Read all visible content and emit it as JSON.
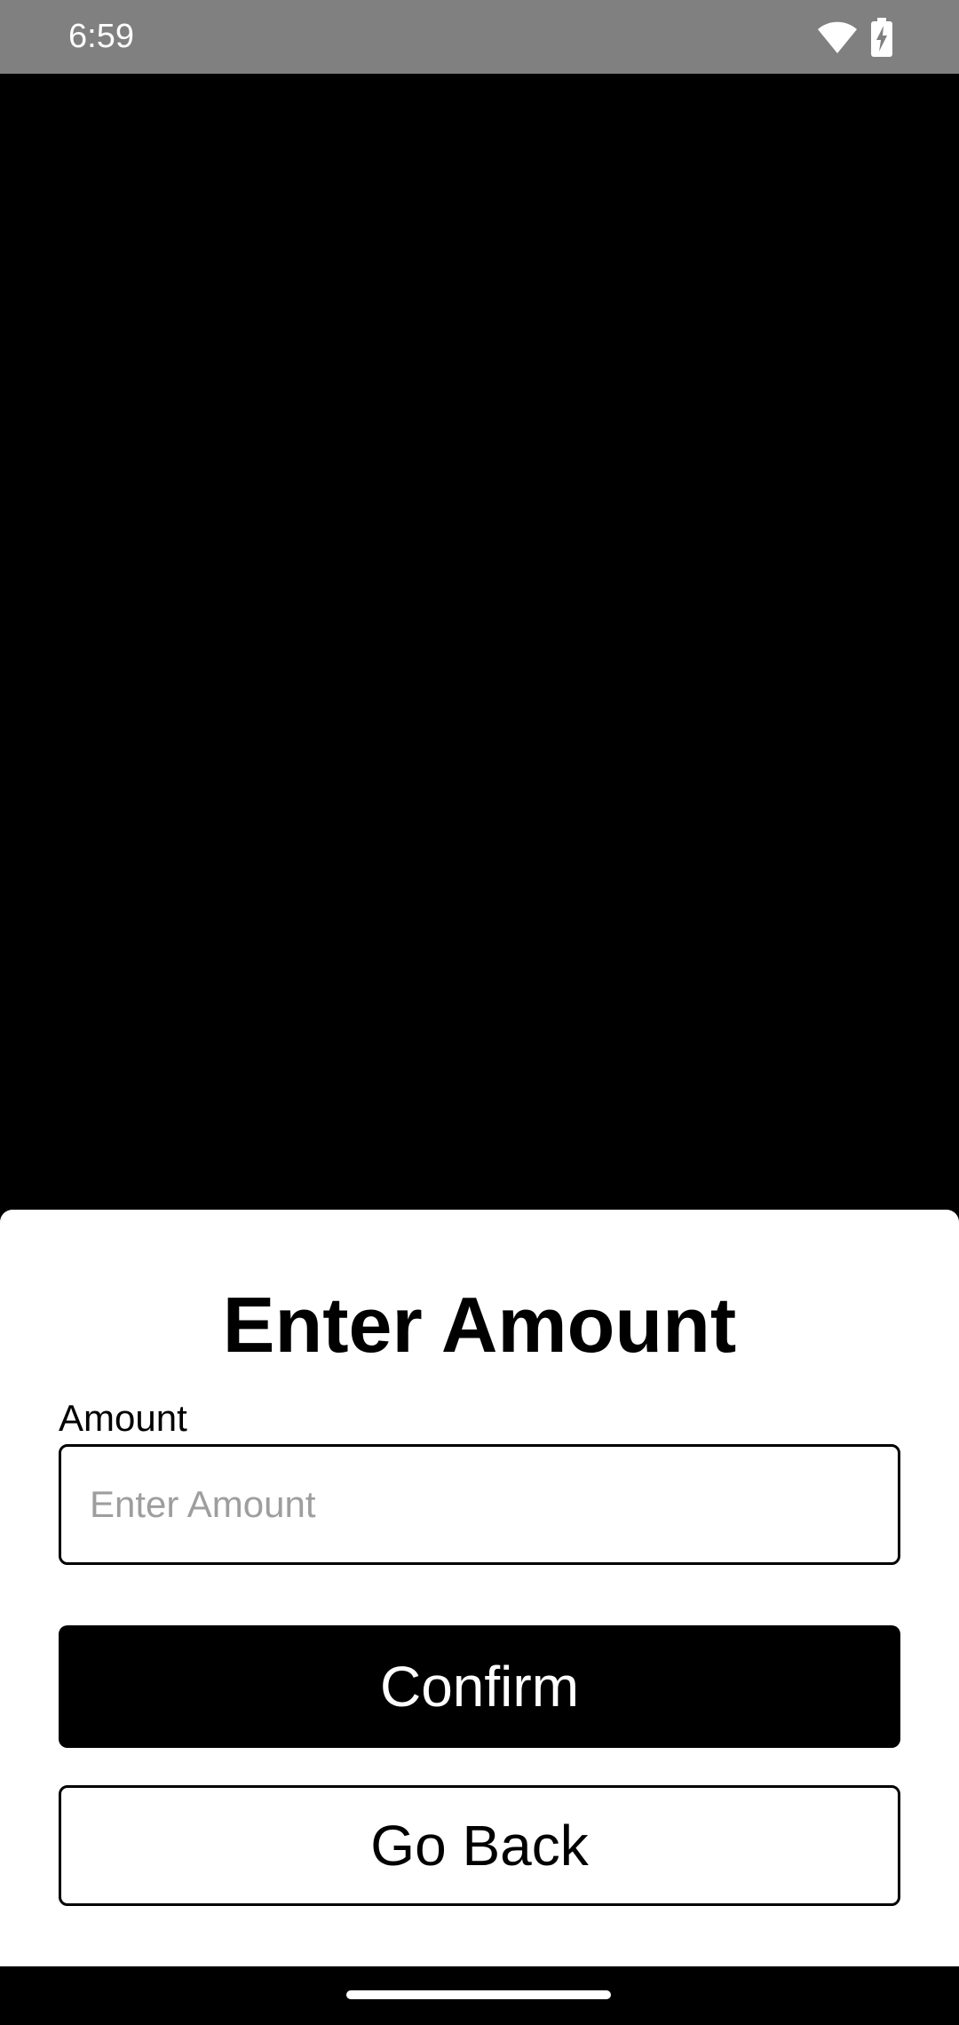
{
  "status_bar": {
    "time": "6:59",
    "icons": [
      "wifi-icon",
      "battery-charging-icon"
    ]
  },
  "sheet": {
    "title": "Enter Amount",
    "amount_label": "Amount",
    "amount_placeholder": "Enter Amount",
    "amount_value": "",
    "confirm_label": "Confirm",
    "back_label": "Go Back"
  },
  "colors": {
    "status_bar_bg": "#808080",
    "backdrop": "#000000",
    "sheet_bg": "#ffffff",
    "primary_button_bg": "#000000",
    "placeholder": "#9e9e9e"
  }
}
